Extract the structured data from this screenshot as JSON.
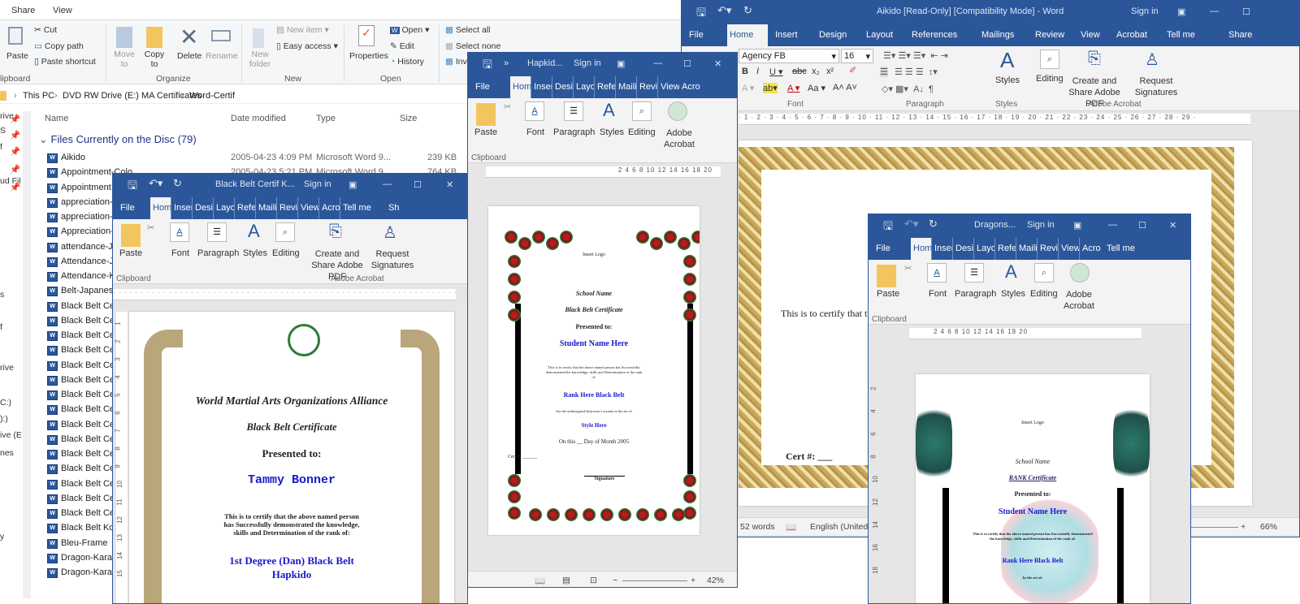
{
  "explorer": {
    "tabs": [
      "Share",
      "View"
    ],
    "ribbon": {
      "clipboard": {
        "paste": "Paste",
        "cut": "Cut",
        "copy_path": "Copy path",
        "paste_shortcut": "Paste shortcut",
        "group": "lipboard"
      },
      "organize": {
        "move_to": "Move to",
        "copy_to": "Copy to",
        "delete": "Delete",
        "rename": "Rename",
        "group": "Organize"
      },
      "new": {
        "new_folder": "New folder",
        "new_item": "New item",
        "easy_access": "Easy access",
        "group": "New"
      },
      "open": {
        "properties": "Properties",
        "open": "Open",
        "edit": "Edit",
        "history": "History",
        "group": "Open"
      },
      "select": {
        "select_all": "Select all",
        "select_none": "Select none",
        "invert": "Inv"
      }
    },
    "breadcrumb": [
      "This PC",
      "DVD RW Drive (E:) MA Certificates",
      "Word-Certif"
    ],
    "columns": [
      "Name",
      "Date modified",
      "Type",
      "Size"
    ],
    "group_header": "Files Currently on the Disc (79)",
    "nav_items": [
      "rive",
      "S",
      "f",
      "ud Fil",
      "s",
      "f",
      "rive",
      "C:)",
      "):)",
      "ive (E",
      "nes",
      "y"
    ],
    "files": [
      {
        "name": "Aikido",
        "date": "2005-04-23 4:09 PM",
        "type": "Microsoft Word 9...",
        "size": "239 KB"
      },
      {
        "name": "Appointment-Colo",
        "date": "2005-04-23 5:21 PM",
        "type": "Microsoft Word 9...",
        "size": "764 KB"
      },
      {
        "name": "Appointment"
      },
      {
        "name": "appreciation-"
      },
      {
        "name": "appreciation-"
      },
      {
        "name": "Appreciation-"
      },
      {
        "name": "attendance-Ja"
      },
      {
        "name": "Attendance-J"
      },
      {
        "name": "Attendance-K"
      },
      {
        "name": "Belt-Japanese"
      },
      {
        "name": "Black Belt Cer"
      },
      {
        "name": "Black Belt Cer"
      },
      {
        "name": "Black Belt Cer"
      },
      {
        "name": "Black Belt Cer"
      },
      {
        "name": "Black Belt Cer"
      },
      {
        "name": "Black Belt Cer"
      },
      {
        "name": "Black Belt Cer"
      },
      {
        "name": "Black Belt Cer"
      },
      {
        "name": "Black Belt Cer"
      },
      {
        "name": "Black Belt Cer"
      },
      {
        "name": "Black Belt Cer"
      },
      {
        "name": "Black Belt Cer"
      },
      {
        "name": "Black Belt Cer"
      },
      {
        "name": "Black Belt Cer"
      },
      {
        "name": "Black Belt Cer"
      },
      {
        "name": "Black Belt Kor"
      },
      {
        "name": "Bleu-Frame"
      },
      {
        "name": "Dragon-Karat"
      },
      {
        "name": "Dragon-Karat"
      }
    ]
  },
  "aikido": {
    "title": "Aikido [Read-Only] [Compatibility Mode] - Word",
    "sign_in": "Sign in",
    "tabs": [
      "File",
      "Home",
      "Insert",
      "Design",
      "Layout",
      "References",
      "Mailings",
      "Review",
      "View",
      "Acrobat",
      "Tell me",
      "Share"
    ],
    "font_name": "Agency FB",
    "font_size": "16",
    "groups": {
      "font": "Font",
      "paragraph": "Paragraph",
      "styles": "Styles",
      "adobe": "Adobe Acrobat"
    },
    "buttons": {
      "styles": "Styles",
      "editing": "Editing",
      "create_share": "Create and Share Adobe PDF",
      "request_sig": "Request Signatures"
    },
    "ruler": "· 1 · 2 · 3 · 4 · 5 · 6 · 7 · 8 · 9 · 10 · 11 · 12 · 13 · 14 · 15 · 16 · 17 · 18 · 19 · 20 · 21 · 22 · 23 · 24 · 25 · 26 · 27 · 28 · 29 ·",
    "doc_text": "This is to certify that t",
    "cert_label": "Cert #: ___",
    "status": {
      "words": "52 words",
      "language": "English (United",
      "zoom": "66%"
    }
  },
  "blackbelt": {
    "title": "Black Belt Certif K...",
    "sign_in": "Sign in",
    "tabs": [
      "File",
      "Hom",
      "Inser",
      "Desi",
      "Layo",
      "Refe",
      "Maili",
      "Revi",
      "View",
      "Acro",
      "Tell me",
      "Sh"
    ],
    "buttons": {
      "paste": "Paste",
      "font": "Font",
      "paragraph": "Paragraph",
      "styles": "Styles",
      "editing": "Editing",
      "create_share": "Create and Share Adobe PDF",
      "request_sig": "Request Signatures"
    },
    "groups": {
      "clipboard": "Clipboard",
      "adobe": "Adobe Acrobat"
    },
    "vruler": [
      "1",
      "2",
      "3",
      "4",
      "5",
      "6",
      "7",
      "8",
      "9",
      "10",
      "11",
      "12",
      "13",
      "14",
      "15"
    ],
    "doc": {
      "org": "World Martial Arts Organizations Alliance",
      "cert": "Black Belt Certificate",
      "presented": "Presented to:",
      "student": "Tammy Bonner",
      "body": "This is to certify that the above named person has Successfully demonstrated the knowledge, skills and Determination of the rank of:",
      "rank": "1st Degree (Dan) Black Belt",
      "style": "Hapkido"
    }
  },
  "hapkido": {
    "title": "Hapkid...",
    "sign_in": "Sign in",
    "tabs": [
      "File",
      "Hom",
      "Inser",
      "Desi",
      "Layo",
      "Refe",
      "Maili",
      "Revi",
      "View",
      "Acro"
    ],
    "buttons": {
      "paste": "Paste",
      "font": "Font",
      "paragraph": "Paragraph",
      "styles": "Styles",
      "editing": "Editing",
      "adobe": "Adobe Acrobat"
    },
    "groups": {
      "clipboard": "Clipboard"
    },
    "ruler": "2    4    6    8    10    12    14    16    18    20",
    "doc": {
      "logo": "Insert Logo",
      "school": "School Name",
      "cert": "Black Belt Certificate",
      "presented": "Presented to:",
      "student": "Student Name Here",
      "body": "This is to certify that the above named person has Successfully demonstrated the knowledge, skills and Determination of the rank of:",
      "rank": "Rank Here Black Belt",
      "instructor": "Are the undersigned Instructor's awards in the art of:",
      "style": "Style Here",
      "date": "On this __ Day of Month 2005",
      "cert_no": "Cert #: ______",
      "signature": "Signature"
    },
    "status": {
      "zoom": "42%"
    }
  },
  "dragons": {
    "title": "Dragons...",
    "sign_in": "Sign in",
    "tabs": [
      "File",
      "Hom",
      "Inser",
      "Desi",
      "Layo",
      "Refe",
      "Maili",
      "Revi",
      "View",
      "Acro",
      "Tell me"
    ],
    "buttons": {
      "paste": "Paste",
      "font": "Font",
      "paragraph": "Paragraph",
      "styles": "Styles",
      "editing": "Editing",
      "adobe": "Adobe Acrobat"
    },
    "groups": {
      "clipboard": "Clipboard"
    },
    "ruler": "2    4    6    8    10    12    14    16    18    20",
    "vruler": [
      "2",
      "4",
      "6",
      "8",
      "10",
      "12",
      "14",
      "16",
      "18"
    ],
    "doc": {
      "logo": "Insert Logo",
      "school": "School Name",
      "cert": "RANK Certificate",
      "presented": "Presented to:",
      "student": "Student Name Here",
      "body": "This is to certify that the above named person has Successfully demonstrated the knowledge, skills and Determination of the rank of:",
      "rank": "Rank Here Black Belt",
      "art": "In the art of:"
    }
  },
  "colors": {
    "word_blue": "#2b579a",
    "cert_blue": "#1a1acc",
    "explorer_heading": "#1e3287"
  }
}
